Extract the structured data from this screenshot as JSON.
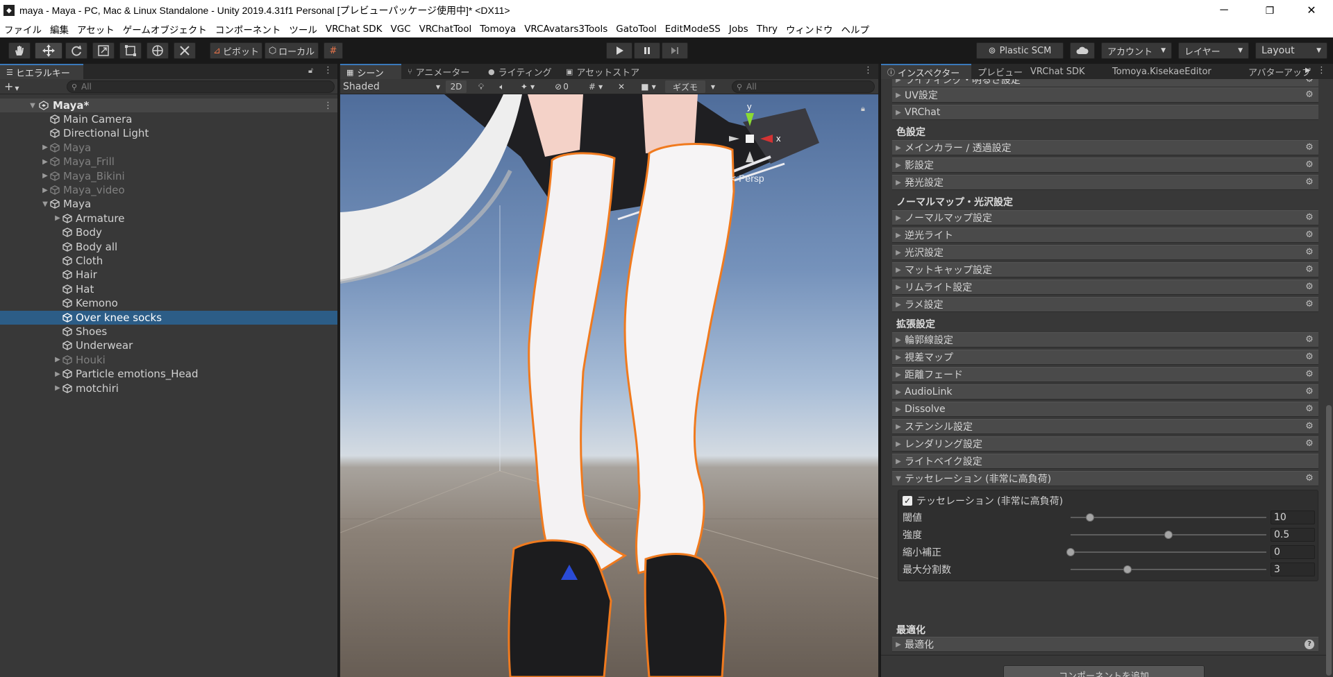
{
  "window": {
    "title": "maya - Maya - PC, Mac & Linux Standalone - Unity 2019.4.31f1 Personal [プレビューパッケージ使用中]* <DX11>",
    "minimize": "─",
    "maximize": "❐",
    "close": "✕"
  },
  "menu": [
    "ファイル",
    "編集",
    "アセット",
    "ゲームオブジェクト",
    "コンポーネント",
    "ツール",
    "VRChat SDK",
    "VGC",
    "VRChatTool",
    "Tomoya",
    "VRCAvatars3Tools",
    "GatoTool",
    "EditModeSS",
    "Jobs",
    "Thry",
    "ウィンドウ",
    "ヘルプ"
  ],
  "toolbar": {
    "pivot": "ピボット",
    "local": "ローカル",
    "plastic_scm": "Plastic SCM",
    "account": "アカウント",
    "layers": "レイヤー",
    "layout": "Layout"
  },
  "hierarchy": {
    "tab": "ヒエラルキー",
    "search_placeholder": "All",
    "scene": "Maya*",
    "rows": [
      {
        "label": "Main Camera",
        "indent": 1,
        "arrow": "",
        "dim": false
      },
      {
        "label": "Directional Light",
        "indent": 1,
        "arrow": "",
        "dim": false
      },
      {
        "label": "Maya",
        "indent": 1,
        "arrow": "▶",
        "dim": true
      },
      {
        "label": "Maya_Frill",
        "indent": 1,
        "arrow": "▶",
        "dim": true
      },
      {
        "label": "Maya_Bikini",
        "indent": 1,
        "arrow": "▶",
        "dim": true
      },
      {
        "label": "Maya_video",
        "indent": 1,
        "arrow": "▶",
        "dim": true
      },
      {
        "label": "Maya",
        "indent": 1,
        "arrow": "▼",
        "dim": false
      },
      {
        "label": "Armature",
        "indent": 2,
        "arrow": "▶",
        "dim": false
      },
      {
        "label": "Body",
        "indent": 2,
        "arrow": "",
        "dim": false
      },
      {
        "label": "Body all",
        "indent": 2,
        "arrow": "",
        "dim": false
      },
      {
        "label": "Cloth",
        "indent": 2,
        "arrow": "",
        "dim": false
      },
      {
        "label": "Hair",
        "indent": 2,
        "arrow": "",
        "dim": false
      },
      {
        "label": "Hat",
        "indent": 2,
        "arrow": "",
        "dim": false
      },
      {
        "label": "Kemono",
        "indent": 2,
        "arrow": "",
        "dim": false
      },
      {
        "label": "Over knee socks",
        "indent": 2,
        "arrow": "",
        "dim": false,
        "selected": true
      },
      {
        "label": "Shoes",
        "indent": 2,
        "arrow": "",
        "dim": false
      },
      {
        "label": "Underwear",
        "indent": 2,
        "arrow": "",
        "dim": false
      },
      {
        "label": "Houki",
        "indent": 2,
        "arrow": "▶",
        "dim": true
      },
      {
        "label": "Particle emotions_Head",
        "indent": 2,
        "arrow": "▶",
        "dim": false
      },
      {
        "label": "motchiri",
        "indent": 2,
        "arrow": "▶",
        "dim": false
      }
    ]
  },
  "scene": {
    "tabs": [
      "シーン",
      "アニメーター",
      "ライティング",
      "アセットストア"
    ],
    "shading": "Shaded",
    "btn_2d": "2D",
    "hidden_count": "0",
    "gizmos": "ギズモ",
    "search_placeholder": "All",
    "persp": "< Persp",
    "axis_x": "x",
    "axis_y": "y"
  },
  "inspector": {
    "tabs": [
      "インスペクター",
      "プレビュー",
      "VRChat SDK",
      "Tomoya.KisekaeEditor",
      "アバターアップ"
    ],
    "top_partial": "ライティング・明るさ設定",
    "group1": [
      "UV設定",
      "VRChat"
    ],
    "section_color": "色設定",
    "color_items": [
      "メインカラー / 透過設定",
      "影設定",
      "発光設定"
    ],
    "section_normal": "ノーマルマップ・光沢設定",
    "normal_items": [
      "ノーマルマップ設定",
      "逆光ライト",
      "光沢設定",
      "マットキャップ設定",
      "リムライト設定",
      "ラメ設定"
    ],
    "section_ext": "拡張設定",
    "ext_items": [
      "輪郭線設定",
      "視差マップ",
      "距離フェード",
      "AudioLink",
      "Dissolve",
      "ステンシル設定",
      "レンダリング設定",
      "ライトベイク設定"
    ],
    "tess_fold": "テッセレーション (非常に高負荷)",
    "tess_toggle": "テッセレーション (非常に高負荷)",
    "params": [
      {
        "label": "閾値",
        "value": "10",
        "fraction": 0.1
      },
      {
        "label": "強度",
        "value": "0.5",
        "fraction": 0.5
      },
      {
        "label": "縮小補正",
        "value": "0",
        "fraction": 0.0
      },
      {
        "label": "最大分割数",
        "value": "3",
        "fraction": 0.29
      }
    ],
    "section_opt": "最適化",
    "opt_item": "最適化",
    "add_component": "コンポーネントを追加"
  },
  "colors": {
    "selection": "#2c5d87",
    "outline": "#f07a1e",
    "accent": "#3a79bb"
  }
}
